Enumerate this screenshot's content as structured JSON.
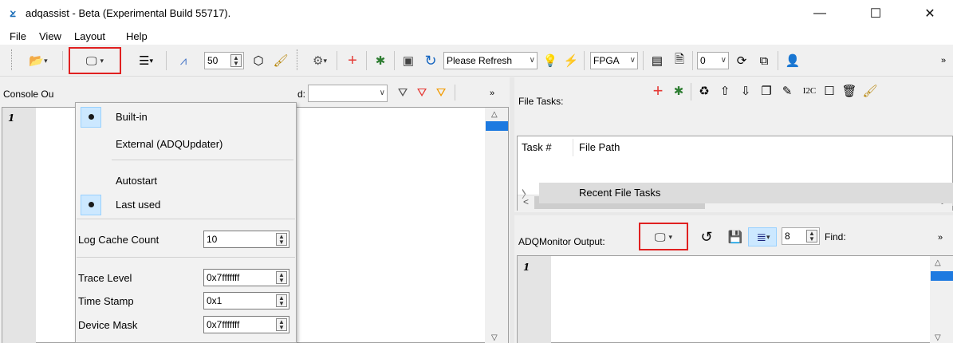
{
  "window": {
    "title": "adqassist - Beta (Experimental Build 55717).",
    "minimize": "—",
    "maximize": "☐",
    "close": "✕"
  },
  "menu": [
    "File",
    "View",
    "Layout",
    "Help"
  ],
  "toolbar": {
    "zoom_value": "50",
    "refresh_select": "Please Refresh",
    "mode_select": "FPGA",
    "index_select": "0",
    "more": "»"
  },
  "console": {
    "label": "Console Ou",
    "find_suffix": "d:",
    "more": "»",
    "line1": "1"
  },
  "file_tasks": {
    "label": "File Tasks:",
    "i2c": "I2C",
    "columns": [
      "Task #",
      "File Path"
    ],
    "rows": [
      "Recent File Tasks"
    ]
  },
  "monitor": {
    "label": "ADQMonitor Output:",
    "count_value": "8",
    "find_label": "Find:",
    "more": "»",
    "line1": "1"
  },
  "dropdown": {
    "builtin": "Built-in",
    "external": "External (ADQUpdater)",
    "autostart": "Autostart",
    "last_used": "Last used",
    "log_cache_label": "Log Cache Count",
    "log_cache_value": "10",
    "trace_label": "Trace Level",
    "trace_value": "0x7fffffff",
    "timestamp_label": "Time Stamp",
    "timestamp_value": "0x1",
    "device_mask_label": "Device Mask",
    "device_mask_value": "0x7fffffff"
  },
  "colors": {
    "accent_blue": "#1e7ae0",
    "highlight_red": "#e02020",
    "icon_red": "#e53935",
    "icon_green": "#2e7d32"
  }
}
